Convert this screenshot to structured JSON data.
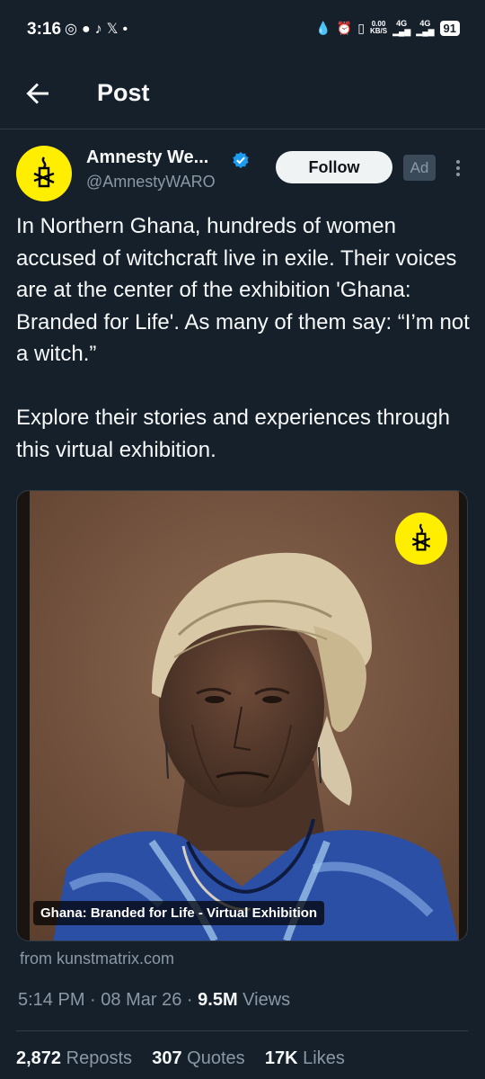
{
  "status_bar": {
    "time": "3:16",
    "left_icons": [
      "whatsapp-icon",
      "chat-icon",
      "tiktok-icon",
      "x-icon",
      "dot-icon"
    ],
    "net_speed_value": "0.00",
    "net_speed_unit": "KB/S",
    "signal_1": "4G",
    "signal_2": "4G",
    "battery": "91"
  },
  "header": {
    "title": "Post",
    "back_icon": "arrow-left-icon"
  },
  "author": {
    "name": "Amnesty We...",
    "handle": "@AmnestyWARO",
    "verified": true,
    "follow_label": "Follow",
    "ad_label": "Ad",
    "brand_color": "#ffee00"
  },
  "post": {
    "text": "In Northern Ghana, hundreds of women accused of witchcraft live in exile. Their voices are at the center of the exhibition 'Ghana: Branded for Life'. As many of them say: “I’m not a witch.”\n\nExplore their stories and experiences through this virtual exhibition.",
    "media_caption": "Ghana: Branded for Life - Virtual Exhibition",
    "link_source": "from kunstmatrix.com"
  },
  "meta": {
    "time": "5:14 PM",
    "date": "08 Mar 26",
    "views_count": "9.5M",
    "views_label": "Views",
    "separator": "·"
  },
  "stats": {
    "reposts_count": "2,872",
    "reposts_label": "Reposts",
    "quotes_count": "307",
    "quotes_label": "Quotes",
    "likes_count": "17K",
    "likes_label": "Likes"
  }
}
